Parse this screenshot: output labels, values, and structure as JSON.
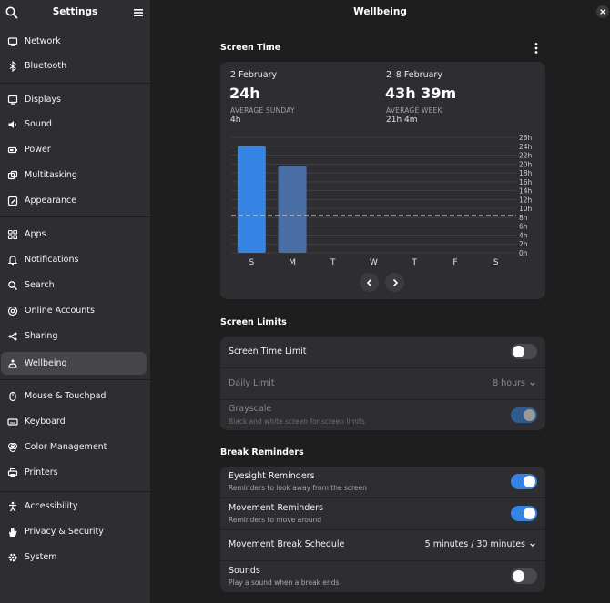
{
  "sidebar": {
    "title": "Settings",
    "items": [
      {
        "label": "Network",
        "icon": "network-icon"
      },
      {
        "label": "Bluetooth",
        "icon": "bluetooth-icon"
      },
      {
        "label": "Displays",
        "icon": "display-icon"
      },
      {
        "label": "Sound",
        "icon": "speaker-icon"
      },
      {
        "label": "Power",
        "icon": "power-icon"
      },
      {
        "label": "Multitasking",
        "icon": "multitasking-icon"
      },
      {
        "label": "Appearance",
        "icon": "appearance-icon"
      },
      {
        "label": "Apps",
        "icon": "apps-grid-icon"
      },
      {
        "label": "Notifications",
        "icon": "bell-icon"
      },
      {
        "label": "Search",
        "icon": "search-icon"
      },
      {
        "label": "Online Accounts",
        "icon": "at-sign-icon"
      },
      {
        "label": "Sharing",
        "icon": "share-icon"
      },
      {
        "label": "Wellbeing",
        "icon": "wellbeing-icon"
      },
      {
        "label": "Mouse & Touchpad",
        "icon": "mouse-icon"
      },
      {
        "label": "Keyboard",
        "icon": "keyboard-icon"
      },
      {
        "label": "Color Management",
        "icon": "color-icon"
      },
      {
        "label": "Printers",
        "icon": "printer-icon"
      },
      {
        "label": "Accessibility",
        "icon": "accessibility-icon"
      },
      {
        "label": "Privacy & Security",
        "icon": "hand-icon"
      },
      {
        "label": "System",
        "icon": "gear-icon"
      }
    ],
    "active": "Wellbeing"
  },
  "content": {
    "title": "Wellbeing",
    "screen_time": {
      "section_title": "Screen Time",
      "day_date": "2 February",
      "day_total": "24h",
      "day_avg_caption": "AVERAGE SUNDAY",
      "day_avg_value": "4h",
      "week_date": "2–8 February",
      "week_total": "43h 39m",
      "week_avg_caption": "AVERAGE WEEK",
      "week_avg_value": "21h 4m"
    },
    "screen_limits": {
      "section_title": "Screen Limits",
      "time_limit_label": "Screen Time Limit",
      "time_limit_on": false,
      "daily_limit_label": "Daily Limit",
      "daily_limit_value": "8 hours",
      "grayscale_label": "Grayscale",
      "grayscale_sub": "Black and white screen for screen limits",
      "grayscale_on": true
    },
    "break_reminders": {
      "section_title": "Break Reminders",
      "eyesight_label": "Eyesight Reminders",
      "eyesight_sub": "Reminders to look away from the screen",
      "eyesight_on": true,
      "movement_label": "Movement Reminders",
      "movement_sub": "Reminders to move around",
      "movement_on": true,
      "schedule_label": "Movement Break Schedule",
      "schedule_value": "5 minutes / 30 minutes",
      "sounds_label": "Sounds",
      "sounds_sub": "Play a sound when a break ends",
      "sounds_on": false
    }
  },
  "colors": {
    "accent": "#3584e4",
    "bar_current": "#3584e4",
    "bar_other": "#4a6fa5"
  },
  "chart_data": {
    "type": "bar",
    "categories": [
      "S",
      "M",
      "T",
      "W",
      "T",
      "F",
      "S"
    ],
    "values": [
      24,
      19.6,
      0,
      0,
      0,
      0,
      0
    ],
    "y_ticks": [
      "0h",
      "2h",
      "4h",
      "6h",
      "8h",
      "10h",
      "12h",
      "14h",
      "16h",
      "18h",
      "20h",
      "22h",
      "24h",
      "26h"
    ],
    "ylim": [
      0,
      26
    ],
    "average_line": 8.4,
    "highlighted_index": 0
  }
}
